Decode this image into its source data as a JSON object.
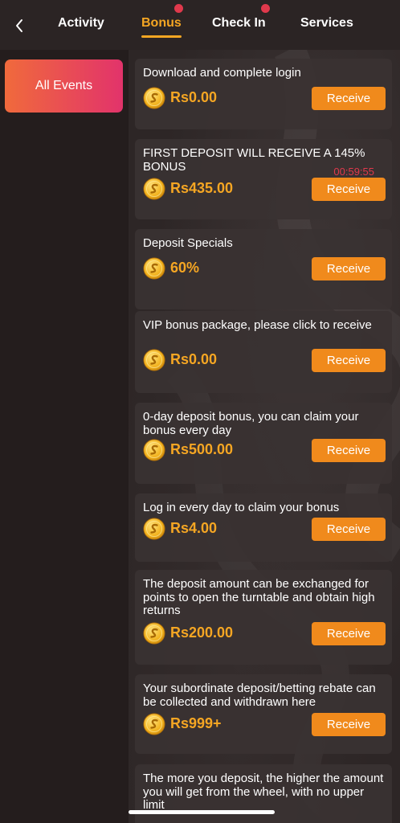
{
  "header": {
    "tabs": [
      {
        "label": "Activity",
        "active": false
      },
      {
        "label": "Bonus",
        "active": true
      },
      {
        "label": "Check In",
        "active": false
      },
      {
        "label": "Services",
        "active": false
      }
    ],
    "back_icon": "chevron-left-icon",
    "accent_color": "#f5a623",
    "dot_color": "#e0394c"
  },
  "sidebar": {
    "items": [
      {
        "label": "All Events",
        "active": true
      }
    ]
  },
  "main": {
    "receive_label": "Receive",
    "coin_icon": "gold-coin-icon",
    "cards": [
      {
        "title": "Download and complete login",
        "amount": "Rs0.00"
      },
      {
        "title": "FIRST DEPOSIT WILL RECEIVE A 145% BONUS",
        "amount": "Rs435.00",
        "countdown": "00:59:55"
      },
      {
        "title": "Deposit Specials",
        "amount": "60%"
      },
      {
        "title": "VIP bonus package, please click to receive",
        "amount": "Rs0.00"
      },
      {
        "title": "0-day deposit bonus, you can claim your bonus every day",
        "amount": "Rs500.00"
      },
      {
        "title": "Log in every day to claim your bonus",
        "amount": "Rs4.00"
      },
      {
        "title": "The deposit amount can be exchanged for points to open the turntable and obtain high returns",
        "amount": "Rs200.00"
      },
      {
        "title": "Your subordinate deposit/betting rebate can be collected and withdrawn here",
        "amount": "Rs999+"
      },
      {
        "title": "The more you deposit, the higher the amount you will get from the wheel, with no upper limit",
        "amount": ""
      }
    ]
  }
}
